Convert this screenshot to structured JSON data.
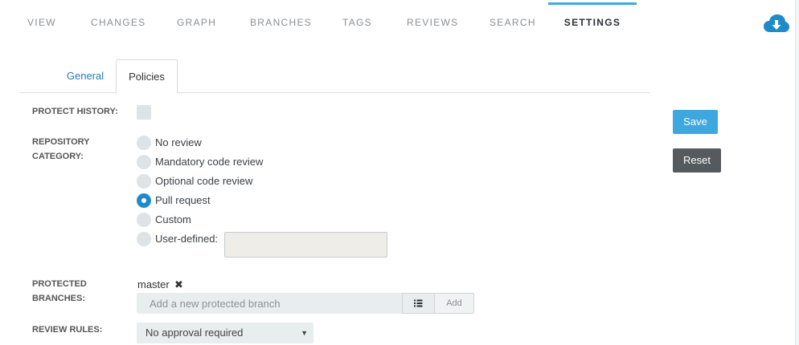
{
  "nav": {
    "tabs": [
      {
        "label": "VIEW"
      },
      {
        "label": "CHANGES"
      },
      {
        "label": "GRAPH"
      },
      {
        "label": "BRANCHES"
      },
      {
        "label": "TAGS"
      },
      {
        "label": "REVIEWS"
      },
      {
        "label": "SEARCH"
      },
      {
        "label": "SETTINGS",
        "active": true
      }
    ],
    "download_icon": "cloud-download-icon"
  },
  "subtabs": {
    "general": "General",
    "policies": "Policies"
  },
  "form": {
    "protect_history": {
      "label": "PROTECT HISTORY:",
      "checked": false
    },
    "repository_category": {
      "label_line1": "REPOSITORY",
      "label_line2": "CATEGORY:",
      "options": [
        {
          "label": "No review",
          "checked": false
        },
        {
          "label": "Mandatory code review",
          "checked": false
        },
        {
          "label": "Optional code review",
          "checked": false
        },
        {
          "label": "Pull request",
          "checked": true
        },
        {
          "label": "Custom",
          "checked": false
        },
        {
          "label": "User-defined:",
          "checked": false
        }
      ],
      "user_defined_value": ""
    },
    "protected_branches": {
      "label_line1": "PROTECTED",
      "label_line2": "BRANCHES:",
      "branches": [
        "master"
      ],
      "remove_glyph": "✖",
      "input_placeholder": "Add a new protected branch",
      "add_label": "Add"
    },
    "review_rules": {
      "label": "REVIEW RULES:",
      "selected": "No approval required"
    }
  },
  "actions": {
    "save": "Save",
    "reset": "Reset"
  },
  "colors": {
    "accent": "#41a9de",
    "radio_checked": "#1f8ac9",
    "save_button": "#3fa7df",
    "reset_button": "#545a5e",
    "link": "#2a7ab0"
  }
}
